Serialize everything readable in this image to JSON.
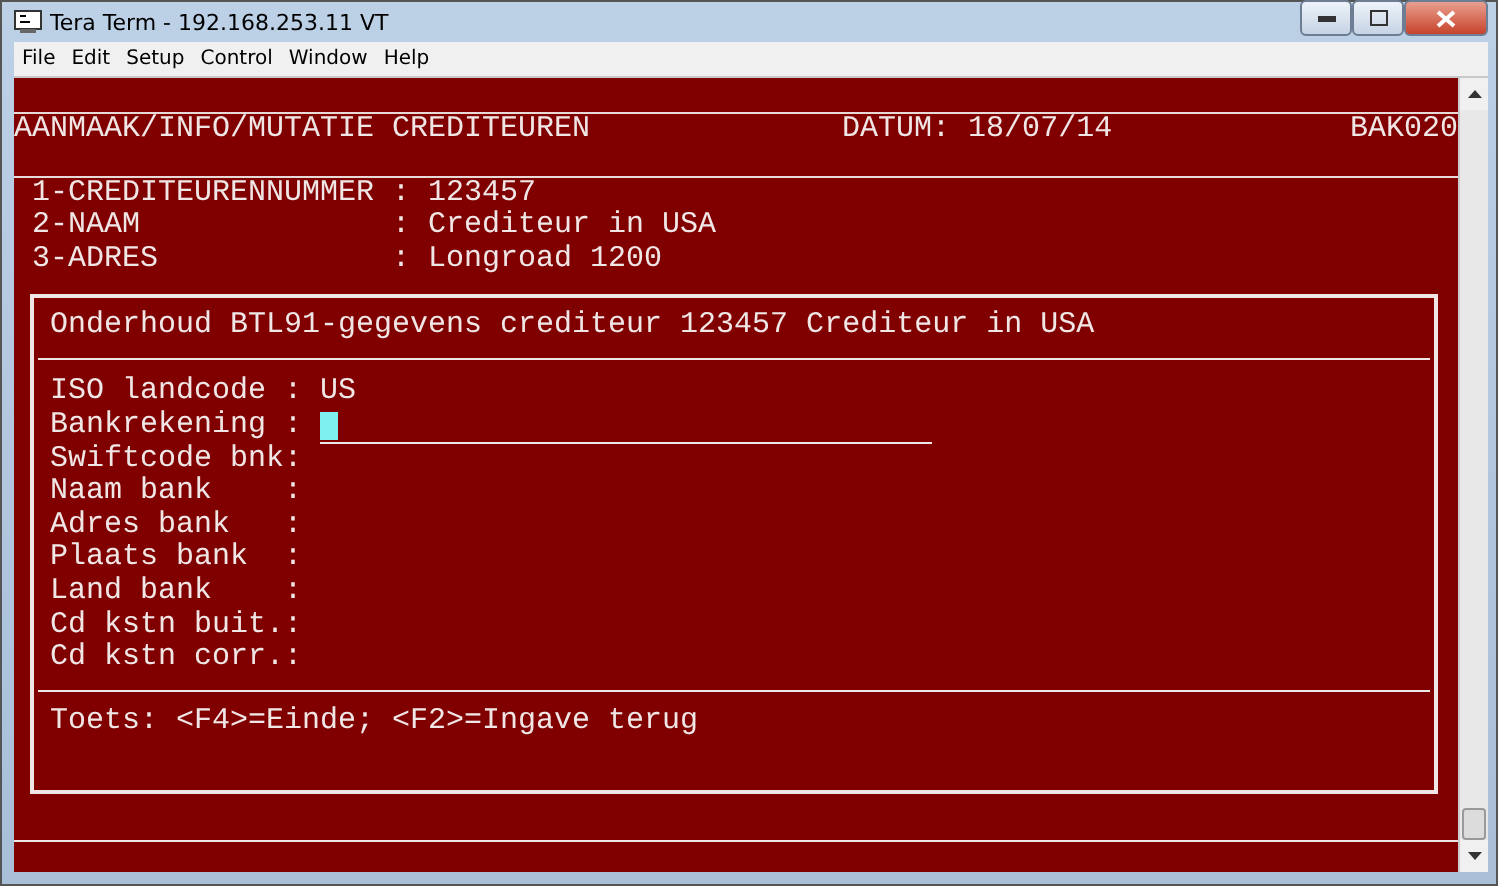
{
  "window": {
    "title": "Tera Term - 192.168.253.11 VT"
  },
  "menu": [
    "File",
    "Edit",
    "Setup",
    "Control",
    "Window",
    "Help"
  ],
  "header": {
    "title": "AANMAAK/INFO/MUTATIE CREDITEUREN",
    "date": "DATUM: 18/07/14",
    "code": "BAK020"
  },
  "crediteur_fields": [
    {
      "label": "1-CREDITEURENNUMMER :",
      "value": "123457"
    },
    {
      "label": "2-NAAM              :",
      "value": "Crediteur in USA"
    },
    {
      "label": "3-ADRES             :",
      "value": "Longroad 1200"
    }
  ],
  "dialog": {
    "title": "Onderhoud BTL91-gegevens crediteur 123457 Crediteur in USA",
    "fields": [
      {
        "label": "ISO landcode :",
        "kind": "text",
        "value": "US"
      },
      {
        "label": "Bankrekening :",
        "kind": "input",
        "focused": true
      },
      {
        "label": "Swiftcode bnk:",
        "kind": "text"
      },
      {
        "label": "Naam bank    :",
        "kind": "text"
      },
      {
        "label": "Adres bank   :",
        "kind": "text"
      },
      {
        "label": "Plaats bank  :",
        "kind": "text"
      },
      {
        "label": "Land bank    :",
        "kind": "text"
      },
      {
        "label": "Cd kstn buit.:",
        "kind": "text"
      },
      {
        "label": "Cd kstn corr.:",
        "kind": "text"
      }
    ],
    "footer": "Toets: <F4>=Einde; <F2>=Ingave terug"
  }
}
